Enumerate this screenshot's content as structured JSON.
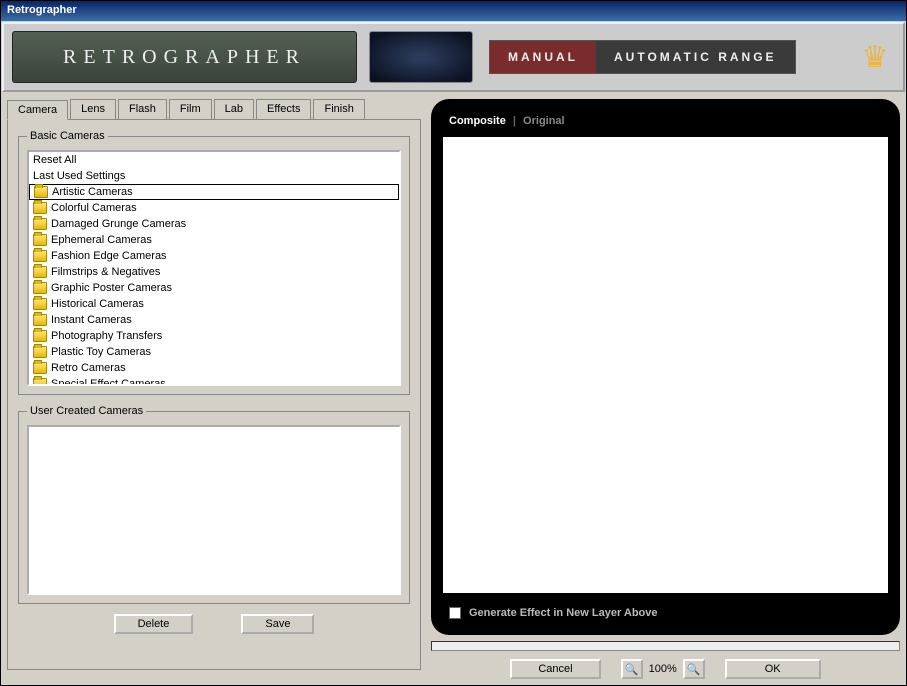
{
  "window": {
    "title": "Retrographer"
  },
  "banner": {
    "logo_text": "RETROGRAPHER",
    "manual": "MANUAL",
    "auto": "AUTOMATIC RANGE"
  },
  "tabs": {
    "camera": "Camera",
    "lens": "Lens",
    "flash": "Flash",
    "film": "Film",
    "lab": "Lab",
    "effects": "Effects",
    "finish": "Finish",
    "active": "camera"
  },
  "basic_group": {
    "legend": "Basic Cameras",
    "items": [
      {
        "label": "Reset All",
        "folder": false
      },
      {
        "label": "Last Used Settings",
        "folder": false
      },
      {
        "label": "Artistic Cameras",
        "folder": true,
        "selected": true
      },
      {
        "label": "Colorful Cameras",
        "folder": true
      },
      {
        "label": "Damaged Grunge Cameras",
        "folder": true
      },
      {
        "label": "Ephemeral Cameras",
        "folder": true
      },
      {
        "label": "Fashion Edge Cameras",
        "folder": true
      },
      {
        "label": "Filmstrips & Negatives",
        "folder": true
      },
      {
        "label": "Graphic Poster Cameras",
        "folder": true
      },
      {
        "label": "Historical Cameras",
        "folder": true
      },
      {
        "label": "Instant Cameras",
        "folder": true
      },
      {
        "label": "Photography Transfers",
        "folder": true
      },
      {
        "label": "Plastic Toy Cameras",
        "folder": true
      },
      {
        "label": "Retro Cameras",
        "folder": true
      },
      {
        "label": "Special Effect Cameras",
        "folder": true
      }
    ]
  },
  "user_group": {
    "legend": "User Created Cameras"
  },
  "left_buttons": {
    "delete": "Delete",
    "save": "Save"
  },
  "preview": {
    "composite": "Composite",
    "original": "Original",
    "generate_label": "Generate Effect in New Layer Above",
    "generate_checked": false
  },
  "bottom": {
    "cancel": "Cancel",
    "zoom": "100%",
    "ok": "OK"
  }
}
